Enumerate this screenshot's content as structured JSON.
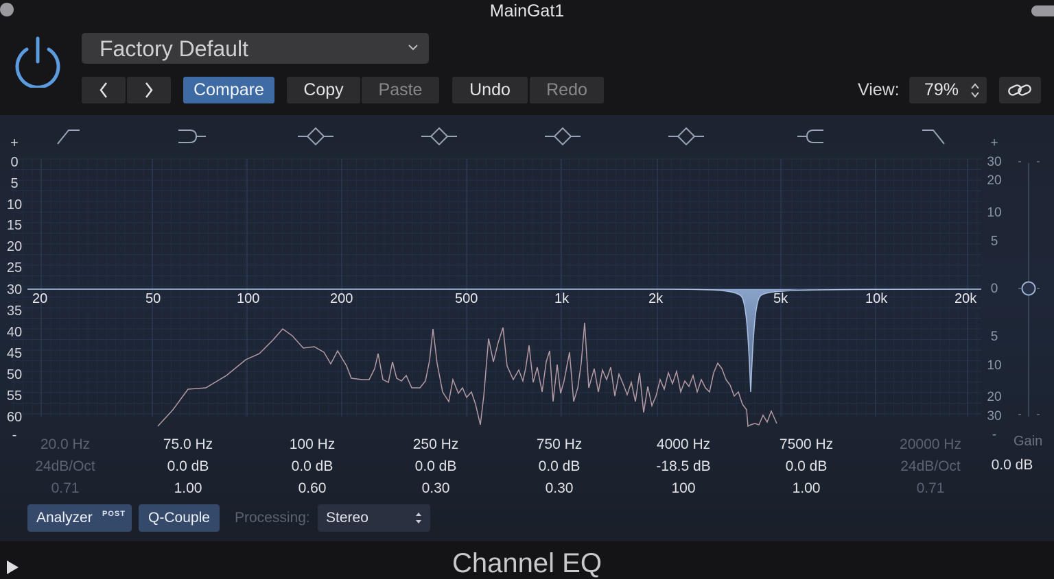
{
  "window": {
    "title": "MainGat1"
  },
  "header": {
    "power_icon": "power-icon",
    "preset": "Factory Default",
    "prev_icon": "chevron-left-icon",
    "next_icon": "chevron-right-icon",
    "compare": "Compare",
    "copy": "Copy",
    "paste": "Paste",
    "undo": "Undo",
    "redo": "Redo",
    "view_label": "View:",
    "view_value": "79%",
    "link_icon": "link-icon"
  },
  "graph": {
    "left_scale": [
      "+",
      "0",
      "5",
      "10",
      "15",
      "20",
      "25",
      "30",
      "35",
      "40",
      "45",
      "50",
      "55",
      "60",
      "-"
    ],
    "right_scale": [
      "+",
      "30",
      "20",
      "10",
      "5",
      "0",
      "5",
      "10",
      "20",
      "30",
      "-"
    ],
    "freq_labels": [
      "20",
      "50",
      "100",
      "200",
      "500",
      "1k",
      "2k",
      "5k",
      "10k",
      "20k"
    ],
    "band_shape_icons": [
      "low-cut-icon",
      "low-shelf-icon",
      "bell-icon",
      "bell-icon",
      "bell-icon",
      "bell-icon",
      "high-shelf-icon",
      "high-cut-icon"
    ]
  },
  "bands": [
    {
      "freq": "20.0 Hz",
      "gain": "24dB/Oct",
      "q": "0.71",
      "enabled": false
    },
    {
      "freq": "75.0 Hz",
      "gain": "0.0 dB",
      "q": "1.00",
      "enabled": true
    },
    {
      "freq": "100 Hz",
      "gain": "0.0 dB",
      "q": "0.60",
      "enabled": true
    },
    {
      "freq": "250 Hz",
      "gain": "0.0 dB",
      "q": "0.30",
      "enabled": true
    },
    {
      "freq": "750 Hz",
      "gain": "0.0 dB",
      "q": "0.30",
      "enabled": true
    },
    {
      "freq": "4000 Hz",
      "gain": "-18.5 dB",
      "q": "100",
      "enabled": true
    },
    {
      "freq": "7500 Hz",
      "gain": "0.0 dB",
      "q": "1.00",
      "enabled": true
    },
    {
      "freq": "20000 Hz",
      "gain": "24dB/Oct",
      "q": "0.71",
      "enabled": false
    }
  ],
  "gain": {
    "label": "Gain",
    "value": "0.0 dB"
  },
  "controls": {
    "analyzer": "Analyzer",
    "analyzer_badge": "POST",
    "q_couple": "Q-Couple",
    "processing_label": "Processing:",
    "processing_value": "Stereo"
  },
  "footer": {
    "plugin_name": "Channel EQ"
  },
  "colors": {
    "accent": "#3e6ba3",
    "curve": "#9fb5d6",
    "analyzer": "#b59aa4",
    "background": "#1e2738"
  }
}
